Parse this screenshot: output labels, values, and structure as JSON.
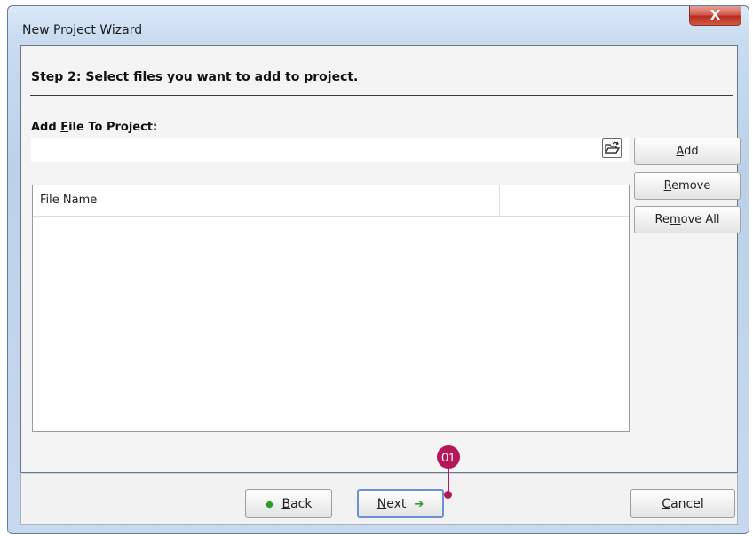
{
  "window": {
    "title": "New Project Wizard",
    "close_label": "X"
  },
  "wizard": {
    "step_title": "Step 2: Select files you want to add to project.",
    "add_file_label_pre": "Add ",
    "add_file_label_key": "F",
    "add_file_label_post": "ile To Project:",
    "file_input_value": "",
    "buttons": {
      "add": {
        "pre": "",
        "key": "A",
        "post": "dd"
      },
      "remove": {
        "pre": "",
        "key": "R",
        "post": "emove"
      },
      "remove_all": {
        "pre": "Re",
        "key": "m",
        "post": "ove All"
      }
    },
    "list": {
      "columns": [
        "File Name",
        ""
      ],
      "rows": []
    }
  },
  "footer": {
    "back": {
      "key": "B",
      "post": "ack",
      "icon": "green-left-arrow"
    },
    "next": {
      "key": "N",
      "post": "ext",
      "icon": "green-right-arrow"
    },
    "cancel": {
      "key": "C",
      "post": "ancel"
    }
  },
  "annotation": {
    "callout_number": "01",
    "color": "#b3185a"
  }
}
